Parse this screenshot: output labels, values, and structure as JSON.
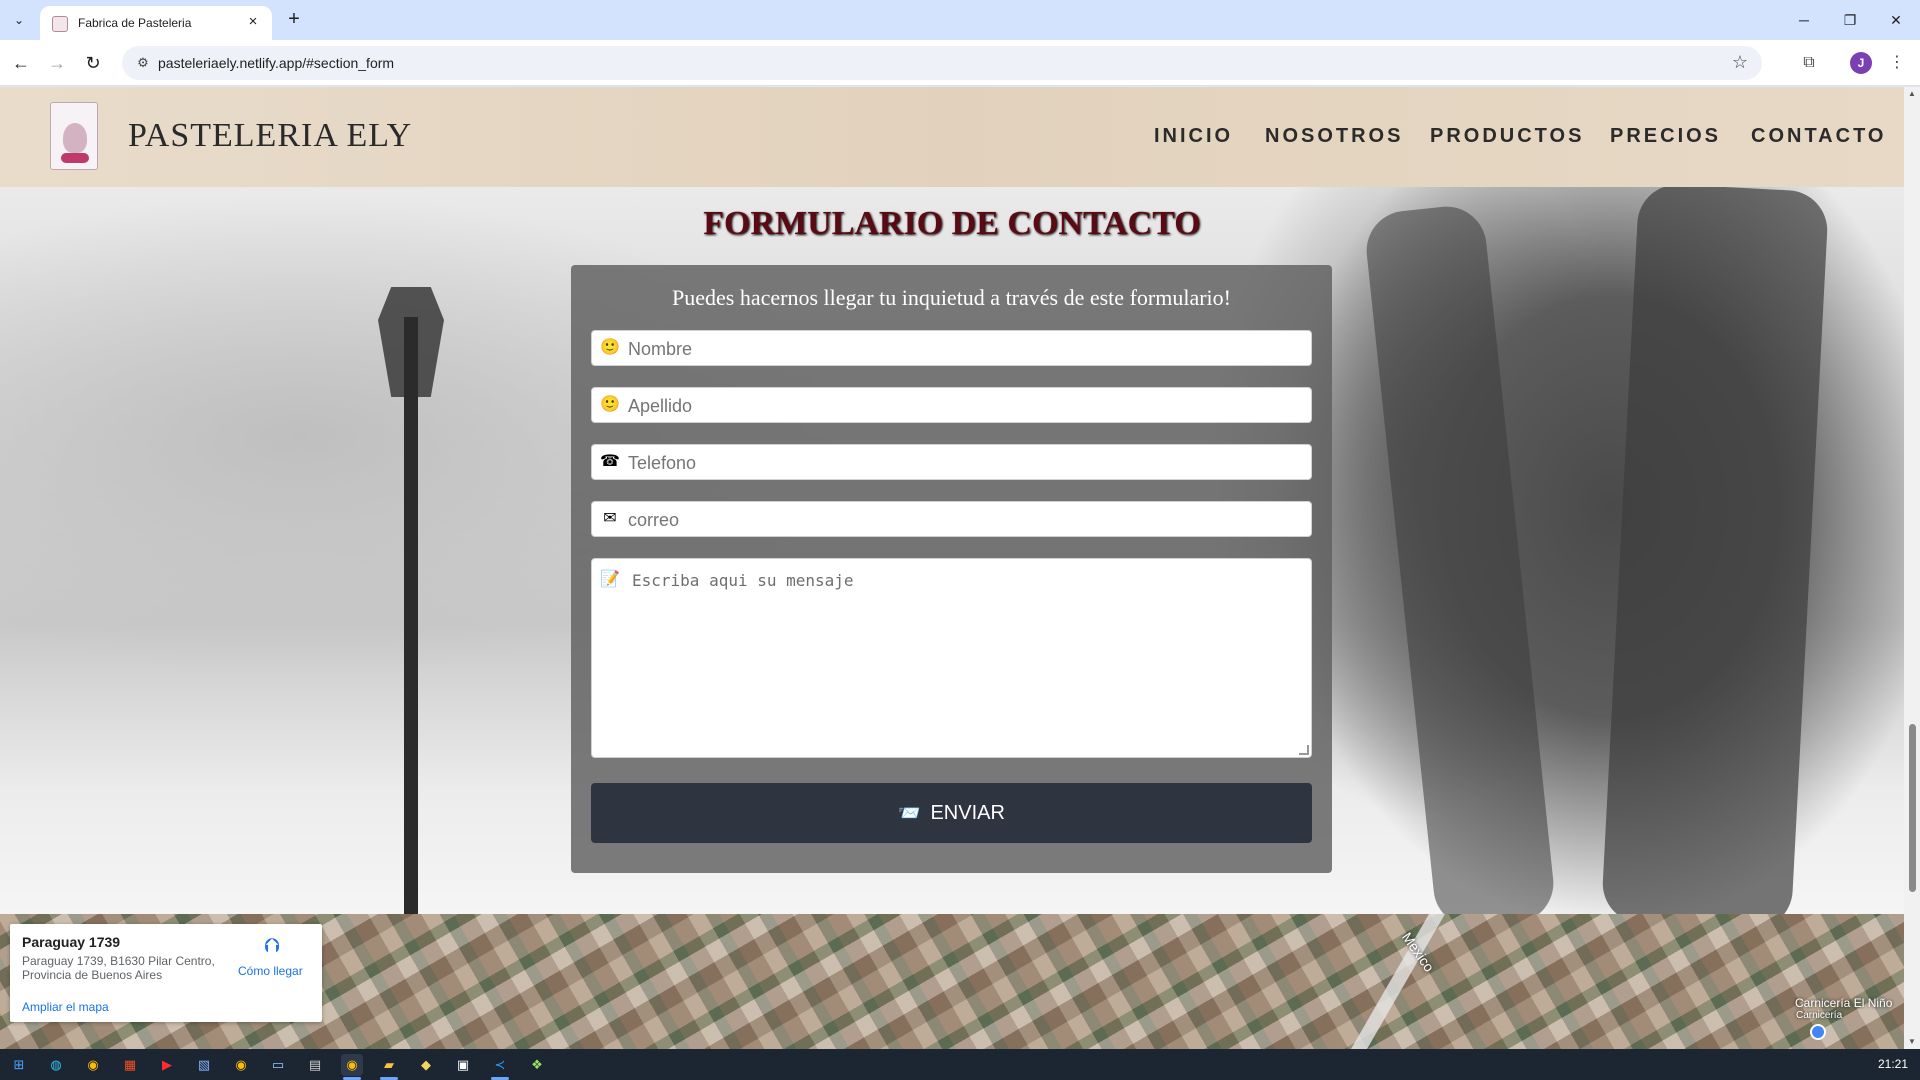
{
  "browser": {
    "tab_title": "Fabrica de Pasteleria",
    "url": "pasteleriaely.netlify.app/#section_form",
    "profile_initial": "J"
  },
  "icons": {
    "tab_list": "chevron-down-icon",
    "close_tab": "close-icon",
    "new_tab": "plus-icon",
    "back": "arrow-left-icon",
    "forward": "arrow-right-icon",
    "reload": "reload-icon",
    "site_info": "tune-icon",
    "bookmark": "star-icon",
    "extensions": "puzzle-icon",
    "menu": "kebab-menu-icon"
  },
  "site": {
    "brand": "PASTELERIA ELY",
    "nav": [
      "INICIO",
      "NOSOTROS",
      "PRODUCTOS",
      "PRECIOS",
      "CONTACTO"
    ]
  },
  "form": {
    "title": "FORMULARIO DE CONTACTO",
    "lead": "Puedes hacernos llegar tu inquietud a través de este formulario!",
    "fields": [
      {
        "icon": "🙂",
        "placeholder": "Nombre"
      },
      {
        "icon": "🙂",
        "placeholder": "Apellido"
      },
      {
        "icon": "☎",
        "placeholder": "Telefono"
      },
      {
        "icon": "✉",
        "placeholder": "correo"
      }
    ],
    "message_icon": "📝",
    "message_placeholder": "Escriba aqui su mensaje",
    "submit_icon": "📨",
    "submit_label": "ENVIAR"
  },
  "map": {
    "place_name": "Paraguay 1739",
    "address": "Paraguay 1739, B1630 Pilar Centro, Provincia de Buenos Aires",
    "directions_label": "Cómo llegar",
    "enlarge_label": "Ampliar el mapa",
    "street_label": "Mexico",
    "poi_label": "Carnicería El Niño",
    "poi_sub": "Carnicería"
  },
  "taskbar": {
    "time": "21:21"
  },
  "colors": {
    "form_title": "#5a0a12",
    "send_button": "#2f3441",
    "header_bg": "#e6d7c4",
    "link_blue": "#1a73e8"
  }
}
